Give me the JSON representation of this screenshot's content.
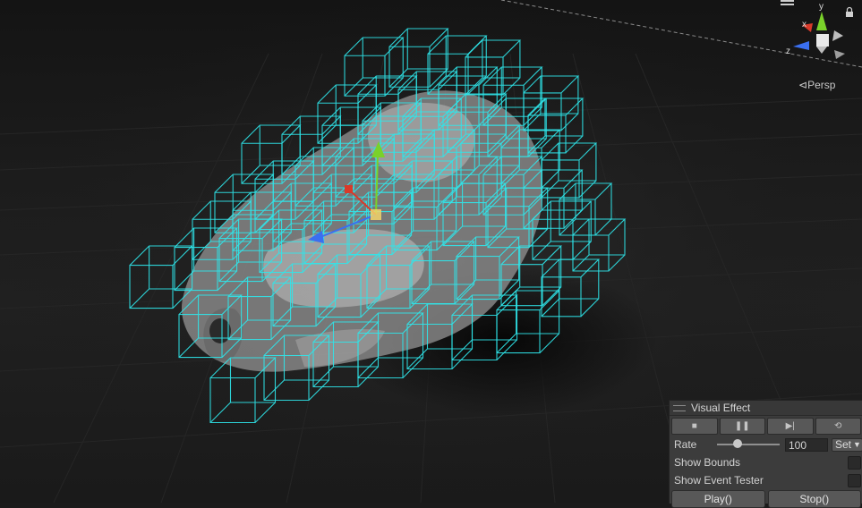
{
  "viewport": {
    "camera_mode_label": "Persp",
    "gizmo": {
      "axis_y": "y",
      "axis_x": "x",
      "axis_z": "z"
    }
  },
  "visual_effect_panel": {
    "title": "Visual Effect",
    "controls": [
      {
        "name": "stop",
        "icon": "stop-icon",
        "glyph": "■"
      },
      {
        "name": "pause",
        "icon": "pause-icon",
        "glyph": "❚❚"
      },
      {
        "name": "step",
        "icon": "step-icon",
        "glyph": "▶|"
      },
      {
        "name": "restart",
        "icon": "restart-icon",
        "glyph": "⟲"
      }
    ],
    "rate_label": "Rate",
    "rate_value": "100",
    "rate_fraction": 0.33,
    "set_label": "Set",
    "show_bounds_label": "Show Bounds",
    "show_bounds_checked": false,
    "show_event_tester_label": "Show Event Tester",
    "show_event_tester_checked": false,
    "play_label": "Play()",
    "stop_label": "Stop()"
  },
  "colors": {
    "bounds_wire": "#2fe6ea",
    "background": "#1b1b1b",
    "panel": "#3c3c3c"
  }
}
